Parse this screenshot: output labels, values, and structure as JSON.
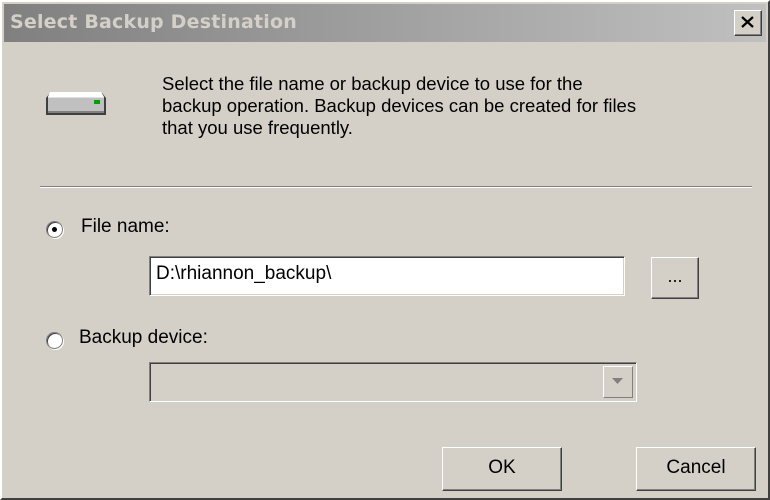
{
  "window": {
    "title": "Select Backup Destination"
  },
  "description": {
    "lines": [
      "Select the file name or backup device to use for the",
      "backup operation.  Backup devices can be created for files",
      "that you use frequently."
    ]
  },
  "options": {
    "file_name": {
      "label": "File name:",
      "selected": true,
      "value": "D:\\rhiannon_backup\\",
      "browse_label": "..."
    },
    "backup_device": {
      "label": "Backup device:",
      "selected": false,
      "value": "",
      "enabled": false
    }
  },
  "buttons": {
    "ok_label": "OK",
    "cancel_label": "Cancel"
  },
  "icons": {
    "device": "backup-device-icon",
    "close": "close-icon",
    "dropdown": "chevron-down-icon"
  },
  "colors": {
    "dialog_bg": "#d4d0c8",
    "titlebar_inactive": "#808080",
    "title_text": "#d4d0c8"
  }
}
